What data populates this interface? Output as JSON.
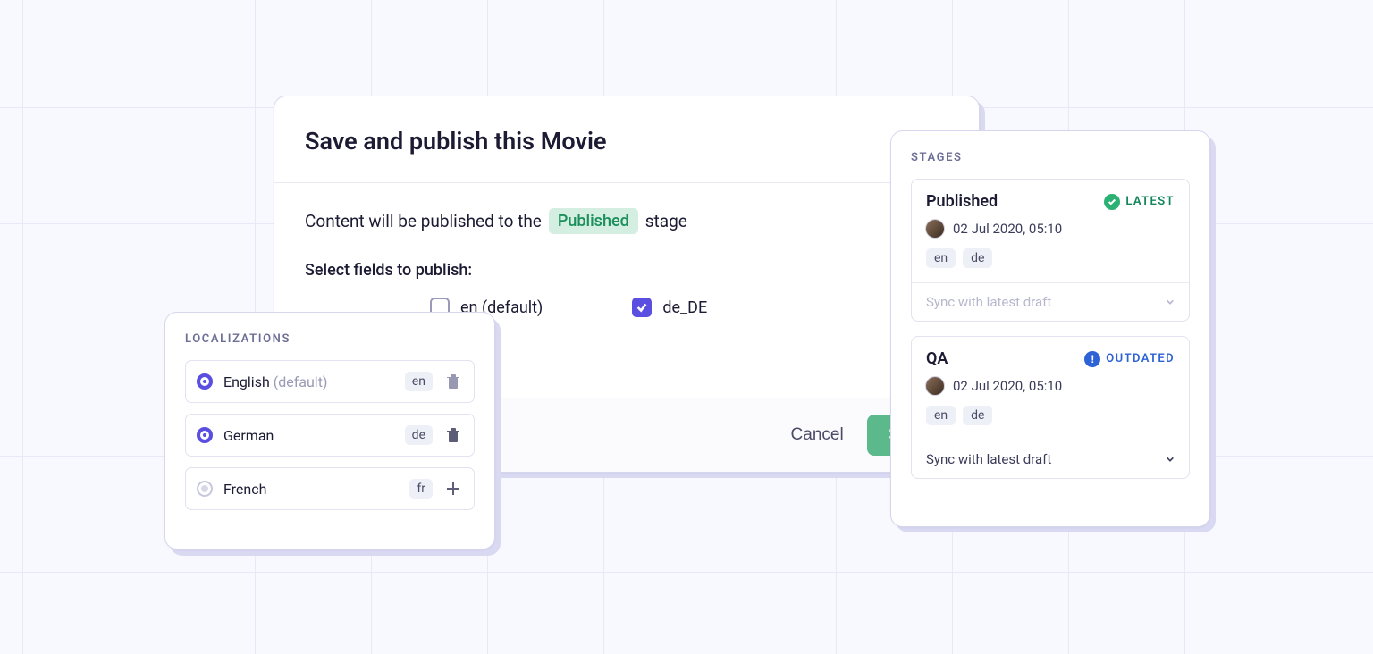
{
  "modal": {
    "title": "Save and publish this Movie",
    "body_prefix": "Content will be published to the",
    "body_stage_badge": "Published",
    "body_suffix": "stage",
    "select_fields_label": "Select fields to publish:",
    "checkboxes": [
      {
        "label": "en (default)",
        "checked": false
      },
      {
        "label": "de_DE",
        "checked": true
      }
    ],
    "cancel": "Cancel",
    "save": "Save"
  },
  "localizations": {
    "caption": "LOCALIZATIONS",
    "items": [
      {
        "name": "English",
        "default_suffix": "(default)",
        "code": "en",
        "active": true,
        "action": "trash-light"
      },
      {
        "name": "German",
        "default_suffix": "",
        "code": "de",
        "active": true,
        "action": "trash-dark"
      },
      {
        "name": "French",
        "default_suffix": "",
        "code": "fr",
        "active": false,
        "action": "plus"
      }
    ]
  },
  "stages": {
    "caption": "STAGES",
    "cards": [
      {
        "name": "Published",
        "status": "latest",
        "status_label": "LATEST",
        "timestamp": "02 Jul 2020, 05:10",
        "locales": [
          "en",
          "de"
        ],
        "sync_label": "Sync with latest draft",
        "sync_enabled": false
      },
      {
        "name": "QA",
        "status": "outdated",
        "status_label": "OUTDATED",
        "timestamp": "02 Jul 2020, 05:10",
        "locales": [
          "en",
          "de"
        ],
        "sync_label": "Sync with latest draft",
        "sync_enabled": true
      }
    ]
  }
}
